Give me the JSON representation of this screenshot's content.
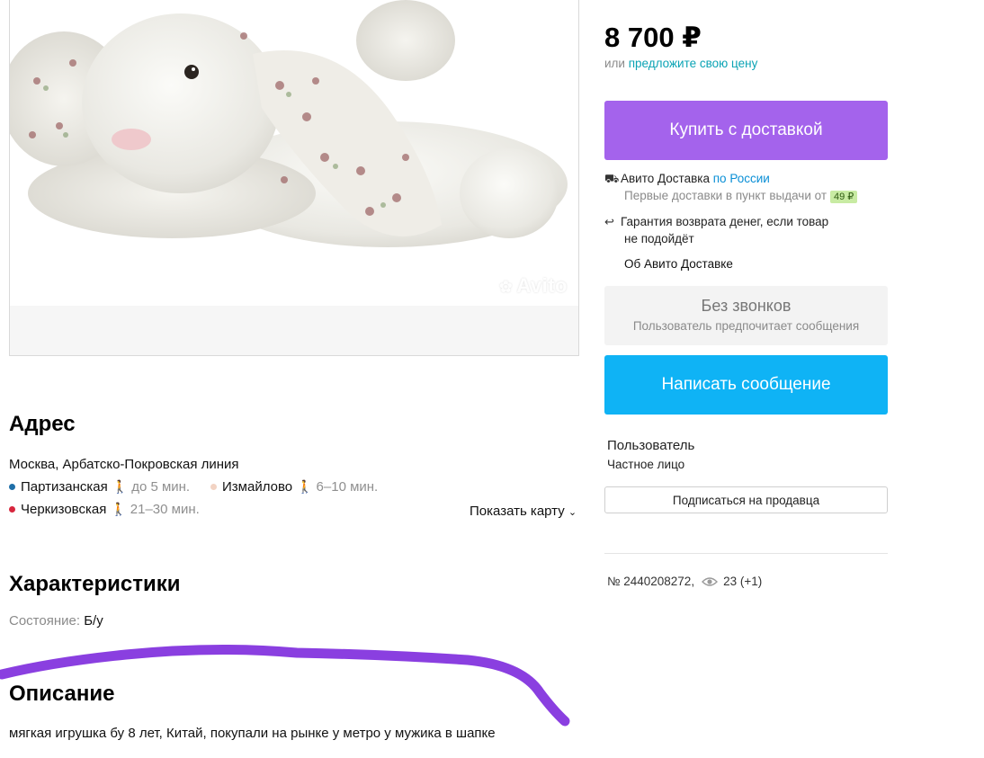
{
  "photo": {
    "watermark": "Avito"
  },
  "address": {
    "heading": "Адрес",
    "line": "Москва, Арбатско-Покровская линия",
    "stations": [
      {
        "name": "Партизанская",
        "time": "до 5 мин.",
        "color": "#1f6fa8"
      },
      {
        "name": "Измайлово",
        "time": "6–10 мин.",
        "color": "#f2d3c3"
      },
      {
        "name": "Черкизовская",
        "time": "21–30 мин.",
        "color": "#d7263d"
      }
    ],
    "show_map": "Показать карту"
  },
  "characteristics": {
    "heading": "Характеристики",
    "condition_label": "Состояние:",
    "condition_value": "Б/у"
  },
  "description": {
    "heading": "Описание",
    "text": "мягкая игрушка бу 8 лет, Китай, покупали на рынке у метро у мужика в шапке"
  },
  "sidebar": {
    "price": "8 700 ₽",
    "offer_prefix": "или",
    "offer_link": "предложите свою цену",
    "buy_button": "Купить с доставкой",
    "delivery_title": "Авито Доставка",
    "delivery_region": "по России",
    "delivery_note": "Первые доставки в пункт выдачи от",
    "delivery_price": "49 ₽",
    "guarantee_line1": "Гарантия возврата денег, если товар",
    "guarantee_line2": "не подойдёт",
    "about_delivery": "Об Авито Доставке",
    "no_calls_title": "Без звонков",
    "no_calls_sub": "Пользователь предпочитает сообщения",
    "message_button": "Написать сообщение",
    "seller_name": "Пользователь",
    "seller_type": "Частное лицо",
    "subscribe_button": "Подписаться на продавца",
    "ad_number": "№ 2440208272,",
    "views": "23 (+1)"
  },
  "colors": {
    "buy": "#a463ec",
    "message": "#0fb3f5",
    "marker": "#8a3fe0"
  }
}
